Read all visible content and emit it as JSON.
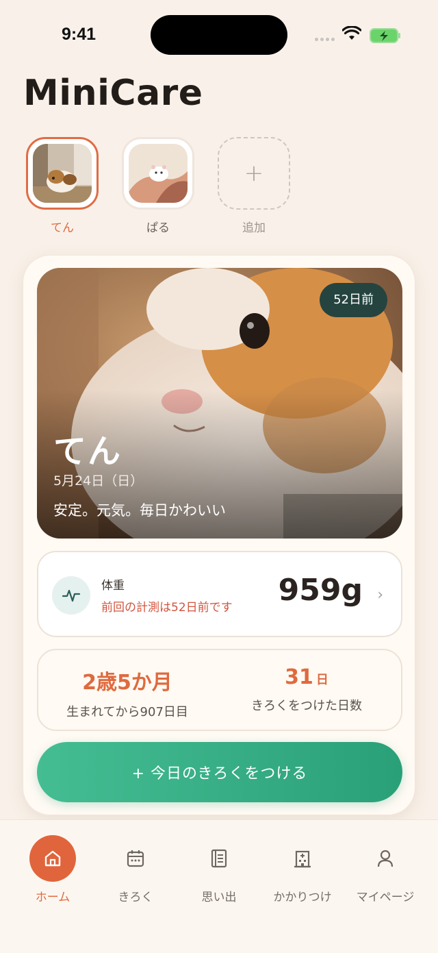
{
  "status_bar": {
    "time": "9:41"
  },
  "app": {
    "title": "MiniCare"
  },
  "pets": [
    {
      "name": "てん",
      "selected": true
    },
    {
      "name": "ぱる",
      "selected": false
    },
    {
      "name": "追加",
      "icon": "plus-icon"
    }
  ],
  "hero": {
    "badge": "52日前",
    "name": "てん",
    "date": "5月24日（日）",
    "note": "安定。元気。毎日かわいい"
  },
  "weight": {
    "label": "体重",
    "sub": "前回の計測は52日前です",
    "value": "959g",
    "icon": "activity-icon"
  },
  "stats": {
    "age": {
      "value": "2歳5か月",
      "label": "生まれてから907日目"
    },
    "days": {
      "value": "31",
      "unit": "日",
      "label": "きろくをつけた日数"
    }
  },
  "cta": {
    "label": "+ 今日のきろくをつける"
  },
  "tabs": [
    {
      "label": "ホーム",
      "icon": "home-icon",
      "active": true
    },
    {
      "label": "きろく",
      "icon": "calendar-icon",
      "active": false
    },
    {
      "label": "思い出",
      "icon": "album-icon",
      "active": false
    },
    {
      "label": "かかりつけ",
      "icon": "hospital-icon",
      "active": false
    },
    {
      "label": "マイページ",
      "icon": "user-icon",
      "active": false
    }
  ],
  "colors": {
    "accent": "#df6a3f",
    "primary_green": "#2aa078",
    "background": "#f9f1e9",
    "badge_bg": "#25443f"
  }
}
